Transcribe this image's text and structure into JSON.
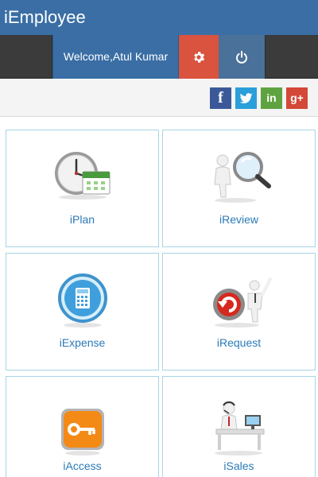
{
  "app": {
    "title": "iEmployee"
  },
  "nav": {
    "welcome": "Welcome,Atul Kumar"
  },
  "social": {
    "facebook": "f",
    "linkedin": "in",
    "googleplus": "g+"
  },
  "tiles": [
    {
      "label": "iPlan",
      "icon": "clock-calendar-icon"
    },
    {
      "label": "iReview",
      "icon": "magnifier-figure-icon"
    },
    {
      "label": "iExpense",
      "icon": "calculator-icon"
    },
    {
      "label": "iRequest",
      "icon": "refresh-figure-icon"
    },
    {
      "label": "iAccess",
      "icon": "key-icon"
    },
    {
      "label": "iSales",
      "icon": "sales-desk-figure-icon"
    }
  ],
  "colors": {
    "header": "#3a6ea5",
    "nav_dark": "#3b3b3b",
    "settings": "#d9533f",
    "power": "#4a7199",
    "tile_border": "#a8d4e6",
    "tile_label": "#2a7ab8"
  }
}
